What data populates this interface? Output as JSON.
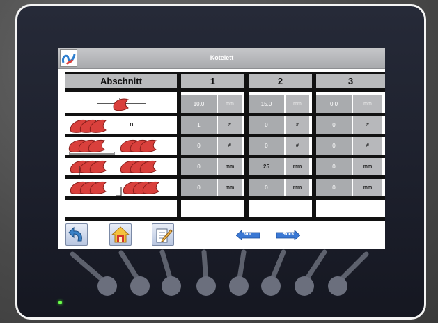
{
  "screen": {
    "title": "Kotelett"
  },
  "table": {
    "header_label": "Abschnitt",
    "columns": [
      "1",
      "2",
      "3"
    ],
    "rows": [
      {
        "icon": "single-cutlet-icon",
        "label": "",
        "cells": [
          {
            "value": "10.0",
            "unit": "mm"
          },
          {
            "value": "15.0",
            "unit": "mm"
          },
          {
            "value": "0.0",
            "unit": "mm"
          }
        ]
      },
      {
        "icon": "cutlet-stack-count-icon",
        "label": "n",
        "cells": [
          {
            "value": "1",
            "unit": "#"
          },
          {
            "value": "0",
            "unit": "#"
          },
          {
            "value": "0",
            "unit": "#"
          }
        ]
      },
      {
        "icon": "cutlet-group-count-icon",
        "label": "",
        "cells": [
          {
            "value": "0",
            "unit": "#"
          },
          {
            "value": "0",
            "unit": "#"
          },
          {
            "value": "0",
            "unit": "#"
          }
        ]
      },
      {
        "icon": "cutlet-gap-a-icon",
        "label": "",
        "cells": [
          {
            "value": "0",
            "unit": "mm"
          },
          {
            "value": "25",
            "unit": "mm"
          },
          {
            "value": "0",
            "unit": "mm"
          }
        ]
      },
      {
        "icon": "cutlet-gap-b-icon",
        "label": "",
        "cells": [
          {
            "value": "0",
            "unit": "mm"
          },
          {
            "value": "0",
            "unit": "mm"
          },
          {
            "value": "0",
            "unit": "mm"
          }
        ]
      }
    ]
  },
  "footer": {
    "back_icon": "back-arrow-icon",
    "home_icon": "home-icon",
    "edit_icon": "edit-icon",
    "prev_label": "Vor",
    "next_label": "Rück"
  },
  "colors": {
    "title_bar": "#b0b1b4",
    "cell_bg": "#a9abae",
    "separator": "#111111",
    "bezel": "#1f2230"
  }
}
